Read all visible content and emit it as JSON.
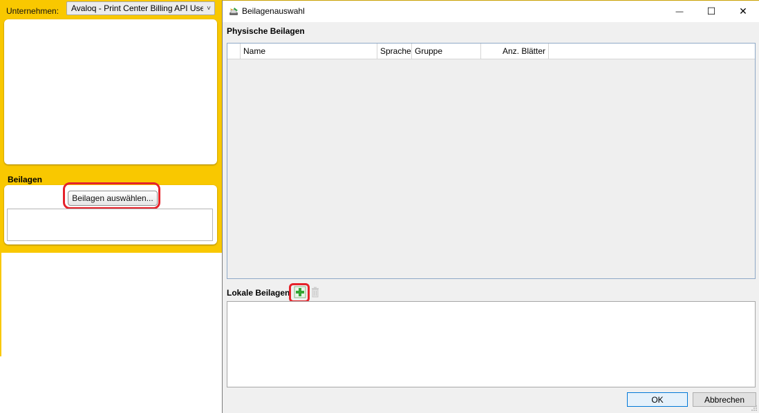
{
  "background_app": {
    "company_label": "Unternehmen:",
    "company_value": "Avaloq - Print Center Billing API Use",
    "inserts_section_title": "Beilagen",
    "select_inserts_button": "Beilagen auswählen...",
    "accent_color": "#f9c800",
    "highlight_color": "#e5222a"
  },
  "dialog": {
    "title": "Beilagenauswahl",
    "window_controls": {
      "minimize": "—",
      "maximize": "☐",
      "close": "✕"
    },
    "physical_section_title": "Physische Beilagen",
    "physical_columns": [
      "Name",
      "Sprache",
      "Gruppe",
      "Anz. Blätter"
    ],
    "local_section_title": "Lokale Beilagen",
    "icons": {
      "add": "add-icon",
      "delete": "trash-icon",
      "app": "app-icon"
    },
    "ok_button": "OK",
    "cancel_button": "Abbrechen"
  }
}
